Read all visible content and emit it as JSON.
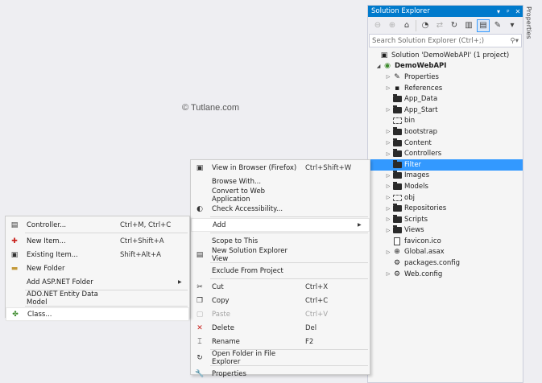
{
  "watermark": "© Tutlane.com",
  "solution_explorer": {
    "title": "Solution Explorer",
    "title_buttons": [
      "▾",
      "ᵖ",
      "✕"
    ],
    "search_placeholder": "Search Solution Explorer (Ctrl+;)",
    "tree": [
      {
        "label": "Solution 'DemoWebAPI' (1 project)",
        "indent": 0,
        "icon": "solution-icon",
        "arrow": ""
      },
      {
        "label": "DemoWebAPI",
        "indent": 1,
        "icon": "web-project-icon",
        "arrow": "◢",
        "bold": true
      },
      {
        "label": "Properties",
        "indent": 2,
        "icon": "wrench-icon",
        "arrow": "▷"
      },
      {
        "label": "References",
        "indent": 2,
        "icon": "references-icon",
        "arrow": "▷"
      },
      {
        "label": "App_Data",
        "indent": 2,
        "icon": "folder-icon",
        "arrow": ""
      },
      {
        "label": "App_Start",
        "indent": 2,
        "icon": "folder-icon",
        "arrow": "▷"
      },
      {
        "label": "bin",
        "indent": 2,
        "icon": "folder-dotted-icon",
        "arrow": ""
      },
      {
        "label": "bootstrap",
        "indent": 2,
        "icon": "folder-icon",
        "arrow": "▷"
      },
      {
        "label": "Content",
        "indent": 2,
        "icon": "folder-icon",
        "arrow": "▷"
      },
      {
        "label": "Controllers",
        "indent": 2,
        "icon": "folder-icon",
        "arrow": "▷"
      },
      {
        "label": "Filter",
        "indent": 2,
        "icon": "folder-icon",
        "arrow": "",
        "selected": true
      },
      {
        "label": "Images",
        "indent": 2,
        "icon": "folder-icon",
        "arrow": "▷"
      },
      {
        "label": "Models",
        "indent": 2,
        "icon": "folder-icon",
        "arrow": "▷"
      },
      {
        "label": "obj",
        "indent": 2,
        "icon": "folder-dotted-icon",
        "arrow": "▷"
      },
      {
        "label": "Repositories",
        "indent": 2,
        "icon": "folder-icon",
        "arrow": "▷"
      },
      {
        "label": "Scripts",
        "indent": 2,
        "icon": "folder-icon",
        "arrow": "▷"
      },
      {
        "label": "Views",
        "indent": 2,
        "icon": "folder-icon",
        "arrow": "▷"
      },
      {
        "label": "favicon.ico",
        "indent": 2,
        "icon": "file-icon",
        "arrow": ""
      },
      {
        "label": "Global.asax",
        "indent": 2,
        "icon": "globe-icon",
        "arrow": "▷"
      },
      {
        "label": "packages.config",
        "indent": 2,
        "icon": "config-icon",
        "arrow": ""
      },
      {
        "label": "Web.config",
        "indent": 2,
        "icon": "config-icon",
        "arrow": "▷"
      }
    ]
  },
  "properties_tab": "Properties",
  "context_menu": [
    {
      "label": "View in Browser (Firefox)",
      "shortcut": "Ctrl+Shift+W",
      "icon": "browser-icon",
      "glyph": "▣"
    },
    {
      "label": "Browse With...",
      "shortcut": "",
      "icon": "",
      "glyph": ""
    },
    {
      "label": "Convert to Web Application",
      "shortcut": "",
      "icon": "",
      "glyph": ""
    },
    {
      "label": "Check Accessibility...",
      "shortcut": "",
      "icon": "accessibility-icon",
      "glyph": "◐"
    },
    {
      "sep": true
    },
    {
      "label": "Add",
      "shortcut": "",
      "icon": "",
      "glyph": "",
      "submenu": true,
      "hover": true
    },
    {
      "sep": true
    },
    {
      "label": "Scope to This",
      "shortcut": "",
      "icon": "",
      "glyph": ""
    },
    {
      "label": "New Solution Explorer View",
      "shortcut": "",
      "icon": "new-view-icon",
      "glyph": "▤"
    },
    {
      "sep": true
    },
    {
      "label": "Exclude From Project",
      "shortcut": "",
      "icon": "",
      "glyph": ""
    },
    {
      "sep": true
    },
    {
      "label": "Cut",
      "shortcut": "Ctrl+X",
      "icon": "scissors-icon",
      "glyph": "✂"
    },
    {
      "label": "Copy",
      "shortcut": "Ctrl+C",
      "icon": "copy-icon",
      "glyph": "❐"
    },
    {
      "label": "Paste",
      "shortcut": "Ctrl+V",
      "icon": "paste-icon",
      "glyph": "▢",
      "disabled": true
    },
    {
      "label": "Delete",
      "shortcut": "Del",
      "icon": "delete-icon",
      "glyph": "✕",
      "color": "#c8201b"
    },
    {
      "label": "Rename",
      "shortcut": "F2",
      "icon": "rename-icon",
      "glyph": "⌶"
    },
    {
      "sep": true
    },
    {
      "label": "Open Folder in File Explorer",
      "shortcut": "",
      "icon": "open-folder-icon",
      "glyph": "↻"
    },
    {
      "sep": true
    },
    {
      "label": "Properties",
      "shortcut": "",
      "icon": "wrench-icon",
      "glyph": "🔧"
    }
  ],
  "add_submenu": [
    {
      "label": "Controller...",
      "shortcut": "Ctrl+M, Ctrl+C",
      "icon": "controller-icon",
      "glyph": "▤"
    },
    {
      "sep": true
    },
    {
      "label": "New Item...",
      "shortcut": "Ctrl+Shift+A",
      "icon": "new-item-icon",
      "glyph": "✚",
      "color": "#c8201b"
    },
    {
      "label": "Existing Item...",
      "shortcut": "Shift+Alt+A",
      "icon": "existing-item-icon",
      "glyph": "▣"
    },
    {
      "label": "New Folder",
      "shortcut": "",
      "icon": "new-folder-icon",
      "glyph": "▬",
      "color": "#c49a3a"
    },
    {
      "label": "Add ASP.NET Folder",
      "shortcut": "",
      "icon": "",
      "glyph": "",
      "submenu": true
    },
    {
      "sep": true
    },
    {
      "label": "ADO.NET Entity Data Model",
      "shortcut": "",
      "icon": "",
      "glyph": ""
    },
    {
      "sep": true
    },
    {
      "label": "Class...",
      "shortcut": "",
      "icon": "class-icon",
      "glyph": "✤",
      "color": "#3c8a2c",
      "hover": true
    }
  ]
}
